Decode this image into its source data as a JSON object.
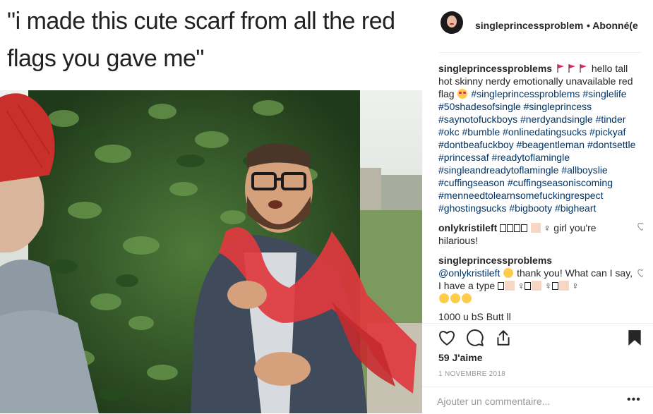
{
  "media": {
    "caption_line1": "\"i made this cute scarf from all the red",
    "caption_line2": "flags you gave me\""
  },
  "header": {
    "username": "singleprincessproblem",
    "follow_status": "• Abonné(e"
  },
  "caption_comment": {
    "username": "singleprincessproblems",
    "text_after_flags": "hello tall hot skinny nerdy emotionally unavailable red flag",
    "hashtags": "#singleprincessproblems #singlelife #50shadesofsingle #singleprincess #saynotofuckboys #nerdyandsingle #tinder #okc #bumble #onlinedatingsucks #pickyaf #dontbeafuckboy #beagentleman #dontsettle #princessaf #readytoflamingle #singleandreadytoflamingle #allboyslie #cuffingseason #cuffingseasoniscoming #menneedtolearnsomefuckingrespect #ghostingsucks #bigbooty #bigheart"
  },
  "comments": [
    {
      "username": "onlykristileft",
      "text": "♀ girl you're hilarious!"
    },
    {
      "username": "singleprincessproblems",
      "mention": "@onlykristileft",
      "text": "thank you! What can I say, I have a type",
      "suffix": "♀"
    }
  ],
  "partial_comment": "1000 u bS Butt ll",
  "icons": {
    "like": "heart-outline-icon",
    "comment": "comment-bubble-icon",
    "share": "share-arrow-icon",
    "save": "bookmark-filled-icon",
    "more": "more-options-icon"
  },
  "likes": "59 J'aime",
  "date": "1 NOVEMBRE 2018",
  "add_comment": {
    "placeholder": "Ajouter un commentaire...",
    "more_label": "•••"
  },
  "colors": {
    "hashtag": "#003569",
    "text": "#262626",
    "muted": "#999999",
    "flag_red": "#e0245e",
    "divider": "#efefef"
  }
}
